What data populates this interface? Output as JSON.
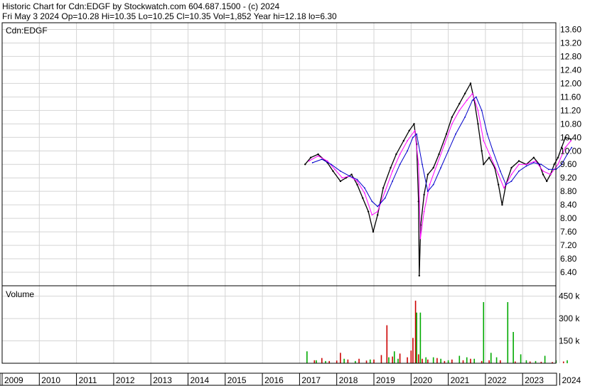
{
  "header": {
    "line1": "Historic Chart for Cdn:EDGF by Stockwatch.com 604.687.1500 - (c) 2024",
    "line2": "Fri May  3 2024   Op=10.28  Hi=10.35  Lo=10.25  Cl=10.35  Vol=1,852  Year hi=12.18  lo=6.30"
  },
  "chart_data": [
    {
      "type": "line",
      "title": "Cdn:EDGF",
      "y_ticks": [
        "13.60",
        "13.20",
        "12.80",
        "12.40",
        "12.00",
        "11.60",
        "11.20",
        "10.80",
        "10.40",
        "10.00",
        "9.60",
        "9.20",
        "8.80",
        "8.40",
        "8.00",
        "7.60",
        "7.20",
        "6.80",
        "6.40"
      ],
      "ylim": [
        6.0,
        13.8
      ],
      "x_ticks": [
        "2009",
        "2010",
        "2011",
        "2012",
        "2013",
        "2014",
        "2015",
        "2016",
        "2017",
        "2018",
        "2019",
        "2020",
        "2021",
        "2022",
        "2023",
        "2024"
      ],
      "series": [
        {
          "color": "#000000",
          "points": [
            [
              2017.15,
              9.6
            ],
            [
              2017.3,
              9.8
            ],
            [
              2017.5,
              9.9
            ],
            [
              2017.75,
              9.65
            ],
            [
              2017.9,
              9.4
            ],
            [
              2018.1,
              9.1
            ],
            [
              2018.25,
              9.2
            ],
            [
              2018.4,
              9.3
            ],
            [
              2018.55,
              9.0
            ],
            [
              2018.7,
              8.6
            ],
            [
              2018.85,
              8.2
            ],
            [
              2018.98,
              7.6
            ],
            [
              2019.1,
              8.1
            ],
            [
              2019.25,
              8.9
            ],
            [
              2019.45,
              9.5
            ],
            [
              2019.6,
              9.9
            ],
            [
              2019.8,
              10.3
            ],
            [
              2019.95,
              10.6
            ],
            [
              2020.08,
              10.8
            ],
            [
              2020.15,
              10.2
            ],
            [
              2020.2,
              8.5
            ],
            [
              2020.22,
              6.3
            ],
            [
              2020.26,
              7.8
            ],
            [
              2020.35,
              8.7
            ],
            [
              2020.45,
              9.3
            ],
            [
              2020.6,
              9.5
            ],
            [
              2020.75,
              9.9
            ],
            [
              2020.95,
              10.5
            ],
            [
              2021.1,
              11.0
            ],
            [
              2021.3,
              11.4
            ],
            [
              2021.45,
              11.7
            ],
            [
              2021.6,
              12.0
            ],
            [
              2021.7,
              11.5
            ],
            [
              2021.8,
              10.8
            ],
            [
              2021.9,
              10.0
            ],
            [
              2021.95,
              9.6
            ],
            [
              2022.1,
              9.8
            ],
            [
              2022.25,
              9.5
            ],
            [
              2022.35,
              9.0
            ],
            [
              2022.45,
              8.4
            ],
            [
              2022.55,
              9.0
            ],
            [
              2022.7,
              9.5
            ],
            [
              2022.9,
              9.7
            ],
            [
              2023.1,
              9.6
            ],
            [
              2023.3,
              9.8
            ],
            [
              2023.45,
              9.6
            ],
            [
              2023.55,
              9.3
            ],
            [
              2023.65,
              9.1
            ],
            [
              2023.75,
              9.3
            ],
            [
              2023.85,
              9.6
            ],
            [
              2023.95,
              9.8
            ],
            [
              2024.05,
              10.1
            ],
            [
              2024.15,
              10.4
            ],
            [
              2024.3,
              10.35
            ]
          ]
        },
        {
          "color": "#ff00ff",
          "points": [
            [
              2017.25,
              9.7
            ],
            [
              2017.5,
              9.85
            ],
            [
              2017.75,
              9.7
            ],
            [
              2017.95,
              9.45
            ],
            [
              2018.15,
              9.2
            ],
            [
              2018.35,
              9.25
            ],
            [
              2018.55,
              9.1
            ],
            [
              2018.75,
              8.75
            ],
            [
              2018.95,
              8.1
            ],
            [
              2019.1,
              8.2
            ],
            [
              2019.3,
              8.8
            ],
            [
              2019.5,
              9.4
            ],
            [
              2019.7,
              9.9
            ],
            [
              2019.9,
              10.3
            ],
            [
              2020.1,
              10.6
            ],
            [
              2020.2,
              9.6
            ],
            [
              2020.25,
              7.4
            ],
            [
              2020.35,
              8.2
            ],
            [
              2020.5,
              9.0
            ],
            [
              2020.7,
              9.6
            ],
            [
              2020.9,
              10.2
            ],
            [
              2021.1,
              10.8
            ],
            [
              2021.3,
              11.2
            ],
            [
              2021.5,
              11.5
            ],
            [
              2021.65,
              11.7
            ],
            [
              2021.8,
              11.2
            ],
            [
              2021.95,
              10.3
            ],
            [
              2022.15,
              9.8
            ],
            [
              2022.35,
              9.3
            ],
            [
              2022.5,
              8.9
            ],
            [
              2022.7,
              9.3
            ],
            [
              2022.9,
              9.6
            ],
            [
              2023.1,
              9.6
            ],
            [
              2023.35,
              9.7
            ],
            [
              2023.55,
              9.4
            ],
            [
              2023.75,
              9.3
            ],
            [
              2023.95,
              9.6
            ],
            [
              2024.15,
              10.1
            ],
            [
              2024.3,
              10.3
            ]
          ]
        },
        {
          "color": "#0000cc",
          "points": [
            [
              2017.35,
              9.65
            ],
            [
              2017.6,
              9.75
            ],
            [
              2017.85,
              9.6
            ],
            [
              2018.1,
              9.4
            ],
            [
              2018.35,
              9.25
            ],
            [
              2018.55,
              9.15
            ],
            [
              2018.75,
              8.9
            ],
            [
              2018.95,
              8.5
            ],
            [
              2019.1,
              8.35
            ],
            [
              2019.3,
              8.6
            ],
            [
              2019.5,
              9.1
            ],
            [
              2019.7,
              9.6
            ],
            [
              2019.9,
              10.0
            ],
            [
              2020.05,
              10.4
            ],
            [
              2020.15,
              10.5
            ],
            [
              2020.3,
              9.6
            ],
            [
              2020.45,
              8.8
            ],
            [
              2020.6,
              9.0
            ],
            [
              2020.8,
              9.5
            ],
            [
              2021.0,
              10.0
            ],
            [
              2021.2,
              10.5
            ],
            [
              2021.45,
              11.0
            ],
            [
              2021.65,
              11.5
            ],
            [
              2021.75,
              11.6
            ],
            [
              2021.9,
              11.2
            ],
            [
              2022.05,
              10.5
            ],
            [
              2022.2,
              10.0
            ],
            [
              2022.4,
              9.4
            ],
            [
              2022.55,
              9.0
            ],
            [
              2022.7,
              9.1
            ],
            [
              2022.9,
              9.4
            ],
            [
              2023.1,
              9.55
            ],
            [
              2023.3,
              9.65
            ],
            [
              2023.5,
              9.6
            ],
            [
              2023.7,
              9.45
            ],
            [
              2023.9,
              9.45
            ],
            [
              2024.05,
              9.6
            ],
            [
              2024.2,
              9.9
            ],
            [
              2024.32,
              10.1
            ]
          ]
        }
      ]
    },
    {
      "type": "bar",
      "title": "Volume",
      "y_ticks": [
        "450 k",
        "300 k",
        "150 k"
      ],
      "ylim": [
        0,
        520000
      ],
      "series": [
        {
          "color": "#cc0000",
          "points": [
            [
              2017.4,
              20000
            ],
            [
              2017.6,
              35000
            ],
            [
              2017.8,
              15000
            ],
            [
              2018.0,
              18000
            ],
            [
              2018.1,
              70000
            ],
            [
              2018.3,
              25000
            ],
            [
              2018.6,
              30000
            ],
            [
              2018.8,
              18000
            ],
            [
              2019.0,
              25000
            ],
            [
              2019.2,
              55000
            ],
            [
              2019.35,
              255000
            ],
            [
              2019.5,
              45000
            ],
            [
              2019.7,
              65000
            ],
            [
              2019.9,
              40000
            ],
            [
              2020.0,
              85000
            ],
            [
              2020.05,
              170000
            ],
            [
              2020.12,
              420000
            ],
            [
              2020.2,
              60000
            ],
            [
              2020.3,
              30000
            ],
            [
              2020.45,
              25000
            ],
            [
              2020.7,
              35000
            ],
            [
              2020.9,
              15000
            ],
            [
              2021.1,
              25000
            ],
            [
              2021.4,
              20000
            ],
            [
              2021.6,
              30000
            ],
            [
              2021.9,
              15000
            ],
            [
              2022.1,
              20000
            ],
            [
              2022.4,
              20000
            ],
            [
              2022.8,
              12000
            ],
            [
              2023.2,
              12000
            ],
            [
              2023.5,
              10000
            ],
            [
              2023.8,
              8000
            ],
            [
              2024.1,
              12000
            ]
          ]
        },
        {
          "color": "#00aa00",
          "points": [
            [
              2017.2,
              80000
            ],
            [
              2017.45,
              20000
            ],
            [
              2017.7,
              15000
            ],
            [
              2018.2,
              30000
            ],
            [
              2018.5,
              15000
            ],
            [
              2018.9,
              25000
            ],
            [
              2019.4,
              40000
            ],
            [
              2019.55,
              80000
            ],
            [
              2019.65,
              30000
            ],
            [
              2020.15,
              340000
            ],
            [
              2020.25,
              340000
            ],
            [
              2020.4,
              40000
            ],
            [
              2020.6,
              40000
            ],
            [
              2020.8,
              30000
            ],
            [
              2021.0,
              20000
            ],
            [
              2021.3,
              50000
            ],
            [
              2021.5,
              40000
            ],
            [
              2021.7,
              30000
            ],
            [
              2021.95,
              410000
            ],
            [
              2022.15,
              70000
            ],
            [
              2022.3,
              40000
            ],
            [
              2022.6,
              410000
            ],
            [
              2022.75,
              210000
            ],
            [
              2022.95,
              60000
            ],
            [
              2023.1,
              20000
            ],
            [
              2023.35,
              15000
            ],
            [
              2023.6,
              50000
            ],
            [
              2023.9,
              20000
            ],
            [
              2024.2,
              20000
            ]
          ]
        }
      ]
    }
  ]
}
